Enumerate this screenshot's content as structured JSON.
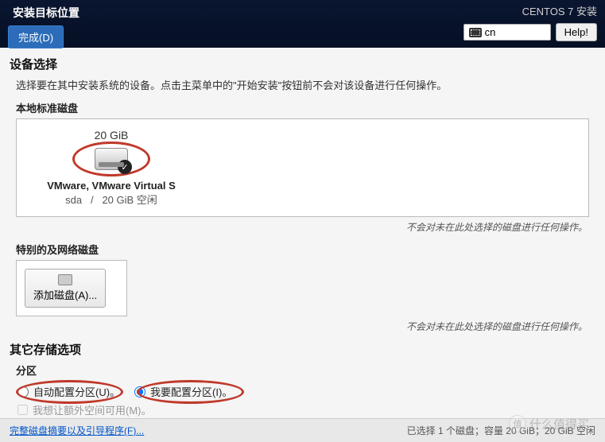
{
  "header": {
    "title": "安装目标位置",
    "done_label": "完成(D)",
    "sub": "CENTOS 7 安装",
    "lang": "cn",
    "help_label": "Help!"
  },
  "device_selection": {
    "title": "设备选择",
    "desc": "选择要在其中安装系统的设备。点击主菜单中的\"开始安装\"按钮前不会对该设备进行任何操作。",
    "local_heading": "本地标准磁盘",
    "disk": {
      "size": "20 GiB",
      "name": "VMware, VMware Virtual S",
      "id": "sda",
      "sep": "/",
      "free": "20 GiB 空闲"
    },
    "note": "不会对未在此处选择的磁盘进行任何操作。",
    "special_heading": "特别的及网络磁盘",
    "add_disk_label": "添加磁盘(A)...",
    "note2": "不会对未在此处选择的磁盘进行任何操作。"
  },
  "other_storage": {
    "title": "其它存储选项",
    "partition_heading": "分区",
    "auto_label": "自动配置分区(U)。",
    "manual_label": "我要配置分区(I)。",
    "extra_checkbox": "我想让额外空间可用(M)。"
  },
  "footer": {
    "link": "完整磁盘摘要以及引导程序(F)...",
    "status": "已选择 1 个磁盘；容量 20 GiB；20 GiB 空闲"
  },
  "watermark": {
    "site": "什么值得买",
    "mark": "值"
  }
}
